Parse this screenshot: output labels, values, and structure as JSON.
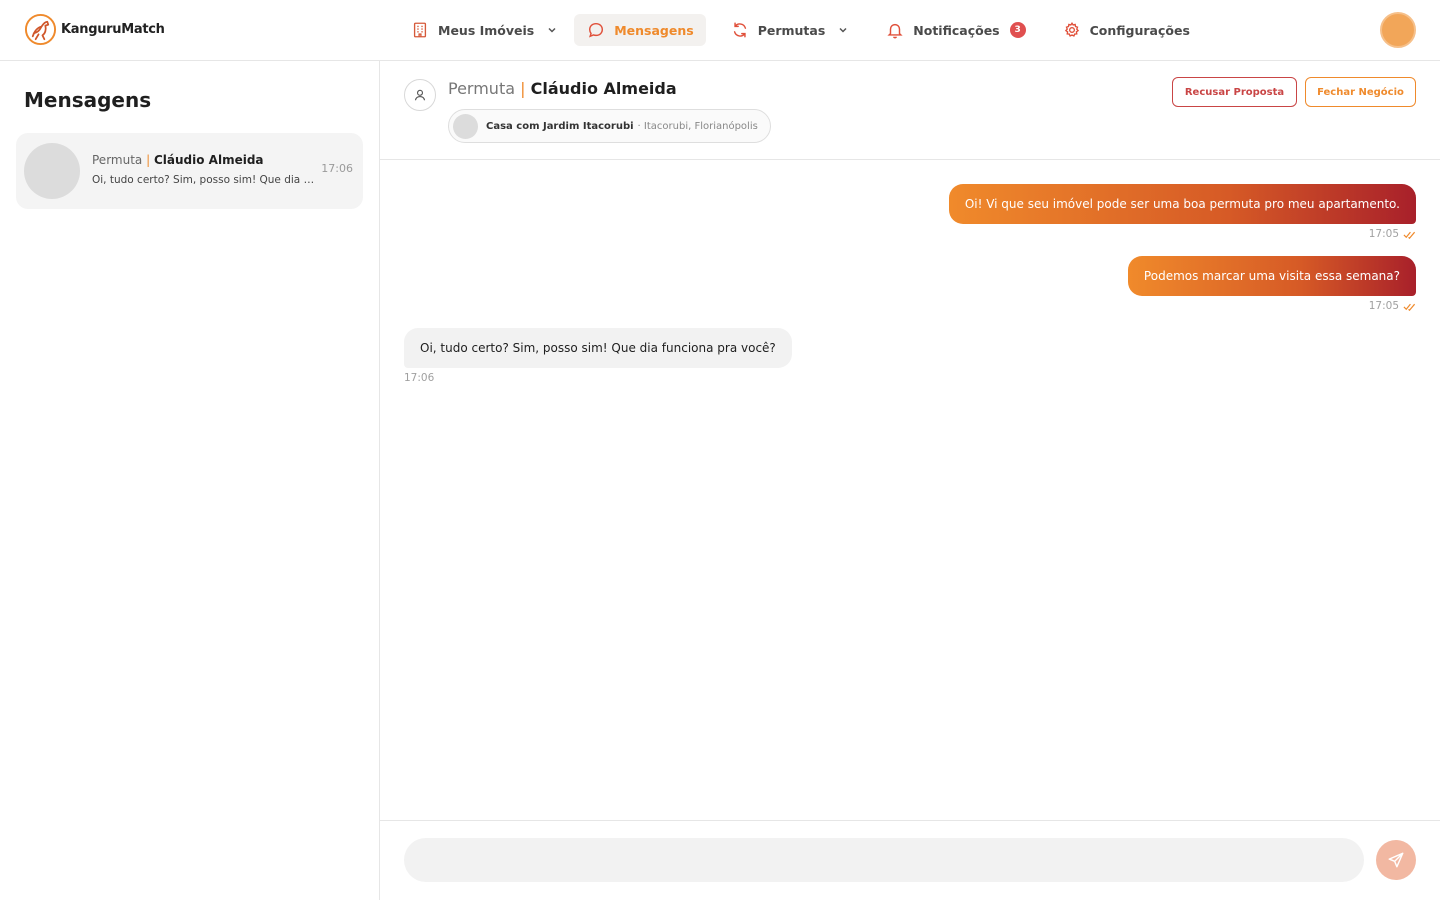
{
  "app": {
    "name": "KanguruMatch"
  },
  "colors": {
    "accent": "#ef8a2c",
    "danger": "#c94545",
    "badge": "#e04f4f",
    "bubble_out_start": "#f08a2b",
    "bubble_out_end": "#a8202a"
  },
  "nav": {
    "items": [
      {
        "label": "Meus Imóveis",
        "icon": "building-icon",
        "has_dropdown": true
      },
      {
        "label": "Mensagens",
        "icon": "chat-bubble-icon",
        "active": true
      },
      {
        "label": "Permutas",
        "icon": "refresh-arrows-icon",
        "has_dropdown": true
      },
      {
        "label": "Notificações",
        "icon": "bell-icon",
        "badge": "3"
      },
      {
        "label": "Configurações",
        "icon": "gear-icon"
      }
    ]
  },
  "sidebar": {
    "title": "Mensagens",
    "conversations": [
      {
        "kind": "Permuta",
        "separator": "|",
        "name": "Cláudio Almeida",
        "preview": "Oi, tudo certo? Sim, posso sim! Que dia funciona pra você?",
        "time": "17:06"
      }
    ]
  },
  "chat": {
    "kind": "Permuta",
    "separator": "|",
    "name": "Cláudio Almeida",
    "property": {
      "name": "Casa com Jardim Itacorubi",
      "location": "· Itacorubi, Florianópolis"
    },
    "actions": {
      "refuse": "Recusar Proposta",
      "close": "Fechar Negócio"
    },
    "messages": [
      {
        "direction": "out",
        "text": "Oi! Vi que seu imóvel pode ser uma boa permuta pro meu apartamento.",
        "time": "17:05",
        "read": true
      },
      {
        "direction": "out",
        "text": "Podemos marcar uma visita essa semana?",
        "time": "17:05",
        "read": true
      },
      {
        "direction": "in",
        "text": "Oi, tudo certo? Sim, posso sim! Que dia funciona pra você?",
        "time": "17:06"
      }
    ],
    "composer": {
      "value": "",
      "placeholder": ""
    }
  }
}
